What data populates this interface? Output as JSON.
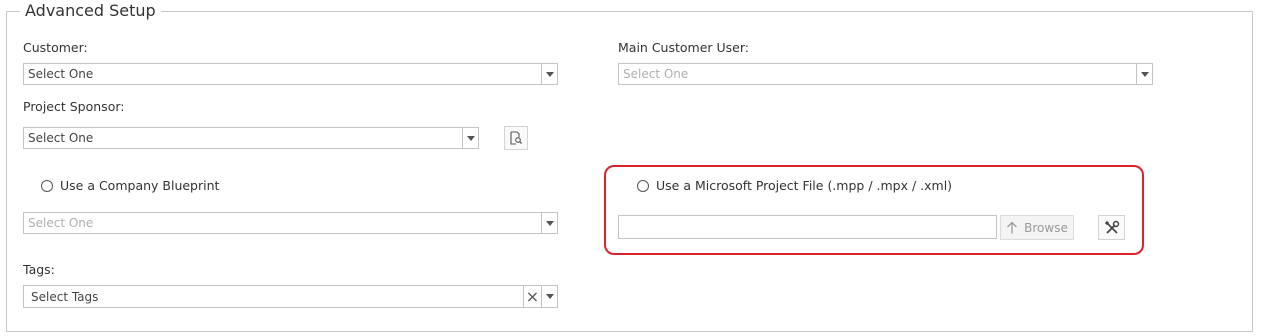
{
  "section": {
    "title": "Advanced Setup"
  },
  "customer": {
    "label": "Customer:",
    "value": "Select One"
  },
  "main_customer_user": {
    "label": "Main Customer User:",
    "value": "Select One"
  },
  "project_sponsor": {
    "label": "Project Sponsor:",
    "value": "Select One"
  },
  "blueprint": {
    "radio_label": "Use a Company Blueprint",
    "value": "Select One"
  },
  "ms_project": {
    "radio_label": "Use a Microsoft Project File (.mpp / .mpx / .xml)",
    "file_value": "",
    "browse_label": "Browse"
  },
  "tags": {
    "label": "Tags:",
    "value": "Select Tags"
  },
  "colors": {
    "highlight_border": "#d9232d",
    "fieldset_border": "#c8c8d0",
    "text": "#333333",
    "disabled_text": "#b0b0b0"
  },
  "icons": {
    "lookup": "search-document-icon",
    "upload": "arrow-up-icon",
    "tools": "wrench-screwdriver-icon",
    "clear": "close-icon",
    "dropdown": "chevron-down-icon"
  }
}
